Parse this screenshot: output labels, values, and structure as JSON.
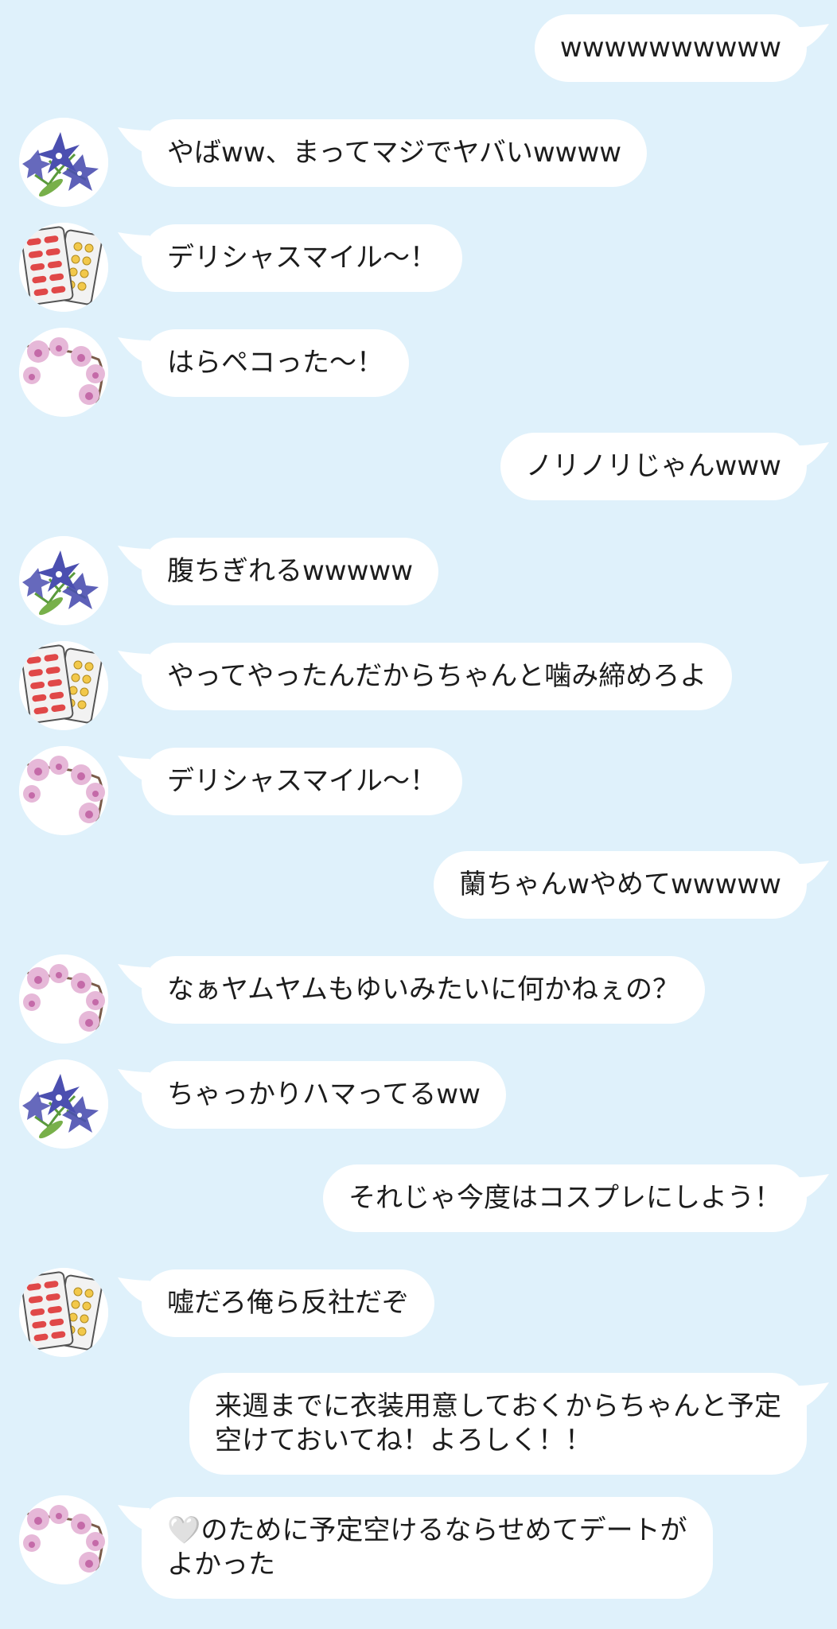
{
  "colors": {
    "background": "#dff1fb",
    "bubble": "#ffffff",
    "text": "#1c1c1c"
  },
  "messages": [
    {
      "side": "out",
      "text": "wwwwwwwwww"
    },
    {
      "side": "in",
      "avatar": "bellflower-icon",
      "text": "やばww、まってマジでヤバいwwww"
    },
    {
      "side": "in",
      "avatar": "pills-icon",
      "text": "デリシャスマイル〜！"
    },
    {
      "side": "in",
      "avatar": "orchid-icon",
      "text": "はらペコった〜！"
    },
    {
      "side": "out",
      "text": "ノリノリじゃんwww"
    },
    {
      "side": "in",
      "avatar": "bellflower-icon",
      "text": "腹ちぎれるwwwww"
    },
    {
      "side": "in",
      "avatar": "pills-icon",
      "text": "やってやったんだからちゃんと噛み締めろよ"
    },
    {
      "side": "in",
      "avatar": "orchid-icon",
      "text": "デリシャスマイル〜！"
    },
    {
      "side": "out",
      "text": "蘭ちゃんwやめてwwwww"
    },
    {
      "side": "in",
      "avatar": "orchid-icon",
      "text": "なぁヤムヤムもゆいみたいに何かねぇの？"
    },
    {
      "side": "in",
      "avatar": "bellflower-icon",
      "text": "ちゃっかりハマってるww"
    },
    {
      "side": "out",
      "text": "それじゃ今度はコスプレにしよう！"
    },
    {
      "side": "in",
      "avatar": "pills-icon",
      "text": "嘘だろ俺ら反社だぞ"
    },
    {
      "side": "out",
      "text": "来週までに衣装用意しておくからちゃんと予定\n空けておいてね！よろしく！！"
    },
    {
      "side": "in",
      "avatar": "orchid-icon",
      "text": "🤍のために予定空けるならせめてデートが\nよかった"
    }
  ]
}
